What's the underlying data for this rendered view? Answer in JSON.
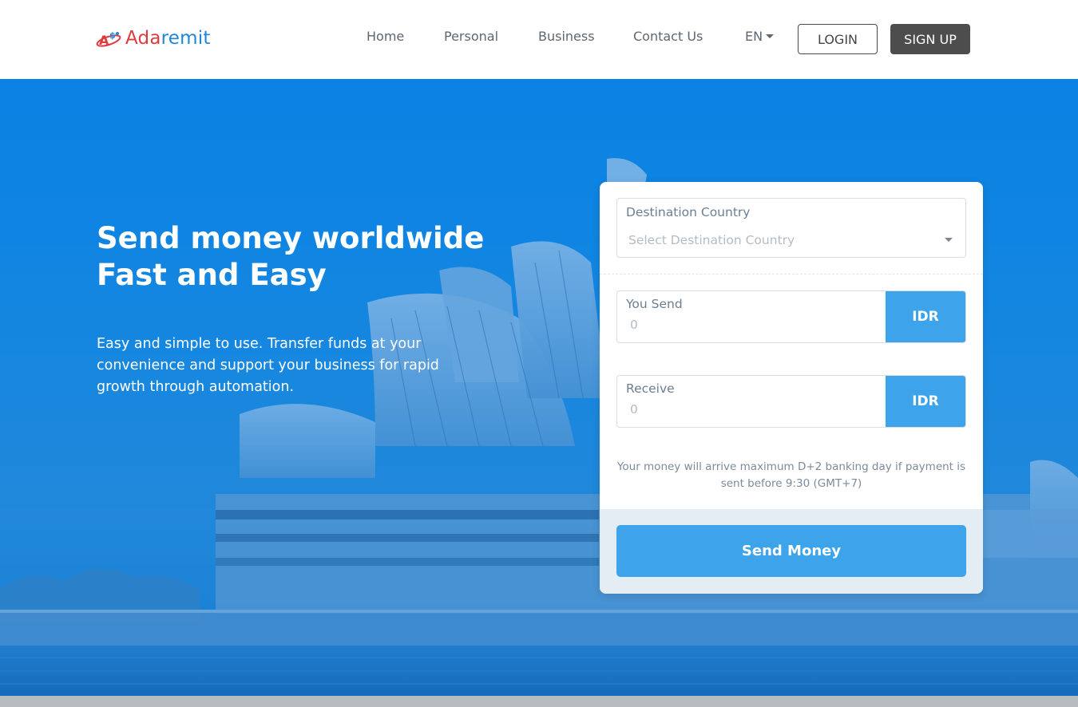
{
  "brand": {
    "name_part1": "Ada",
    "name_part2": "remit",
    "icon": "adaremit-logo-icon",
    "colors": {
      "red": "#e03a3e",
      "blue": "#1f86d8"
    }
  },
  "nav": {
    "items": [
      "Home",
      "Personal",
      "Business",
      "Contact Us"
    ],
    "language": "EN",
    "login_label": "LOGIN",
    "signup_label": "SIGN UP"
  },
  "hero": {
    "headline_line1": "Send money worldwide",
    "headline_line2": "Fast and Easy",
    "subtext": "Easy and simple to use. Transfer funds at your convenience and support your business for rapid growth through automation.",
    "background_image": "sydney-opera-house-blue-overlay",
    "accent_color": "#0a82e3"
  },
  "form": {
    "destination": {
      "label": "Destination Country",
      "placeholder": "Select Destination Country"
    },
    "you_send": {
      "label": "You Send",
      "value": "0",
      "currency": "IDR"
    },
    "receive": {
      "label": "Receive",
      "value": "0",
      "currency": "IDR"
    },
    "note": "Your money will arrive maximum D+2 banking day if payment is sent before 9:30 (GMT+7)",
    "submit_label": "Send Money",
    "button_color": "#3da3ea"
  }
}
